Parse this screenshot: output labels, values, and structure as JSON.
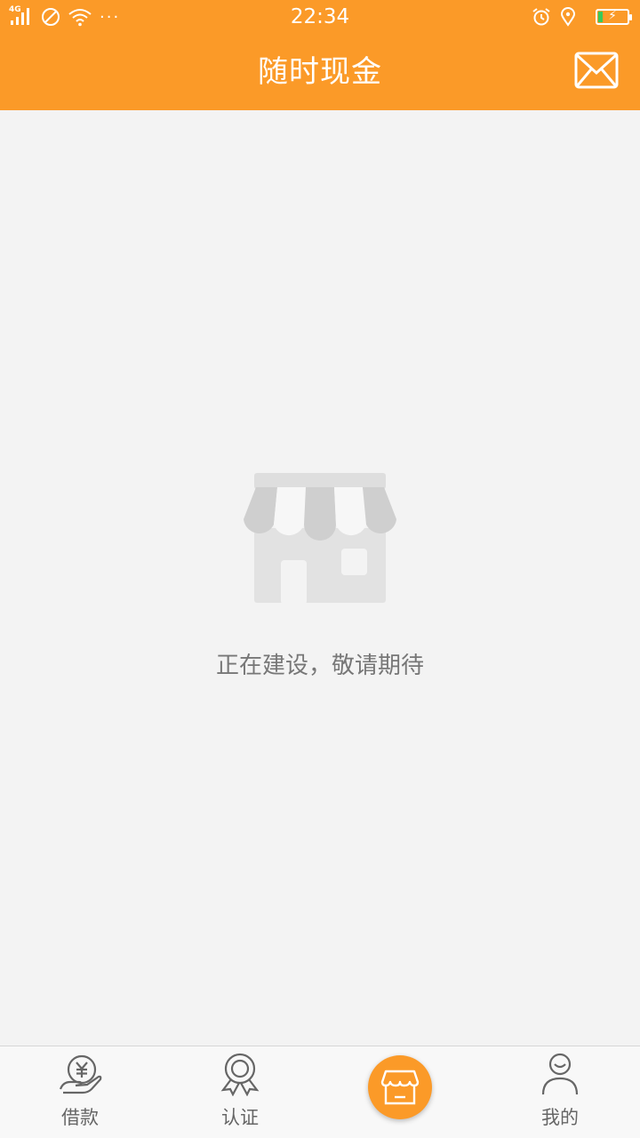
{
  "status_bar": {
    "network": "4G",
    "time": "22:34",
    "more": "···"
  },
  "header": {
    "title": "随时现金",
    "mail_icon": "envelope-icon"
  },
  "content": {
    "empty_icon": "storefront-icon",
    "empty_message": "正在建设，敬请期待"
  },
  "tabs": [
    {
      "label": "借款",
      "icon": "yen-hand-icon"
    },
    {
      "label": "认证",
      "icon": "badge-ribbon-icon"
    },
    {
      "label": "",
      "icon": "storefront-icon",
      "active": true
    },
    {
      "label": "我的",
      "icon": "person-icon"
    }
  ],
  "colors": {
    "brand": "#fb9a28",
    "background": "#f3f3f3",
    "placeholder_grey": "#dcdcdc"
  }
}
